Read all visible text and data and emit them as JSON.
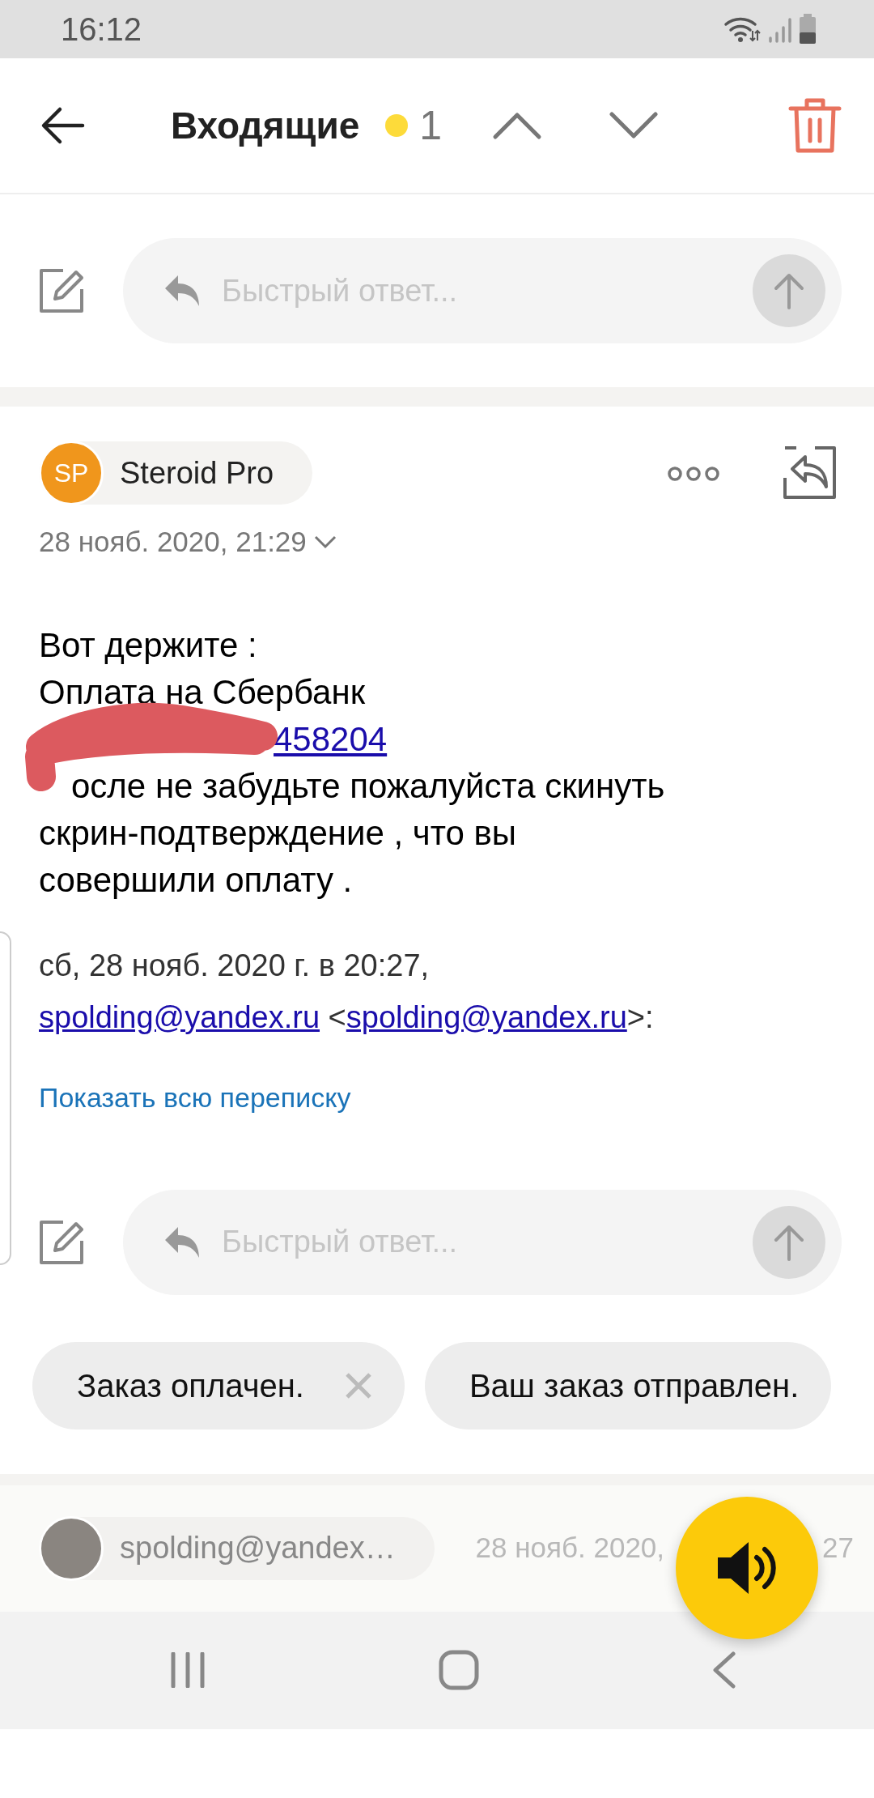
{
  "status_bar": {
    "time": "16:12"
  },
  "header": {
    "title": "Входящие",
    "unread_count": "1"
  },
  "quick_reply_top": {
    "placeholder": "Быстрый ответ..."
  },
  "message": {
    "sender_initials": "SP",
    "sender": "Steroid Pro",
    "date": "28 нояб. 2020, 21:29",
    "redacted": true,
    "body_lines": [
      {
        "kind": "text",
        "text": "Вот держите :"
      },
      {
        "kind": "text",
        "text": "Оплата на Сбербанк"
      },
      {
        "kind": "link",
        "text": "458204"
      },
      {
        "kind": "text",
        "text": "осле не забудьте пожалуйста скинуть"
      },
      {
        "kind": "text",
        "text": "скрин-подтверждение , что вы"
      },
      {
        "kind": "text",
        "text": "совершили оплату ."
      }
    ],
    "quote_header": "сб, 28 нояб. 2020 г. в 20:27,",
    "quote_from": {
      "link": "spolding@yandex.ru",
      "open": "<",
      "email": "spolding@yandex.ru",
      "close": ">:"
    },
    "show_thread": "Показать всю переписку"
  },
  "quick_reply_bottom": {
    "placeholder": "Быстрый ответ..."
  },
  "suggestions": [
    {
      "text": "Заказ оплачен.",
      "dismissible": true
    },
    {
      "text": "Ваш заказ отправлен.",
      "dismissible": false
    }
  ],
  "next_message": {
    "sender": "spolding@yandex…",
    "date_start": "28 нояб. 2020,",
    "date_end": "27"
  }
}
